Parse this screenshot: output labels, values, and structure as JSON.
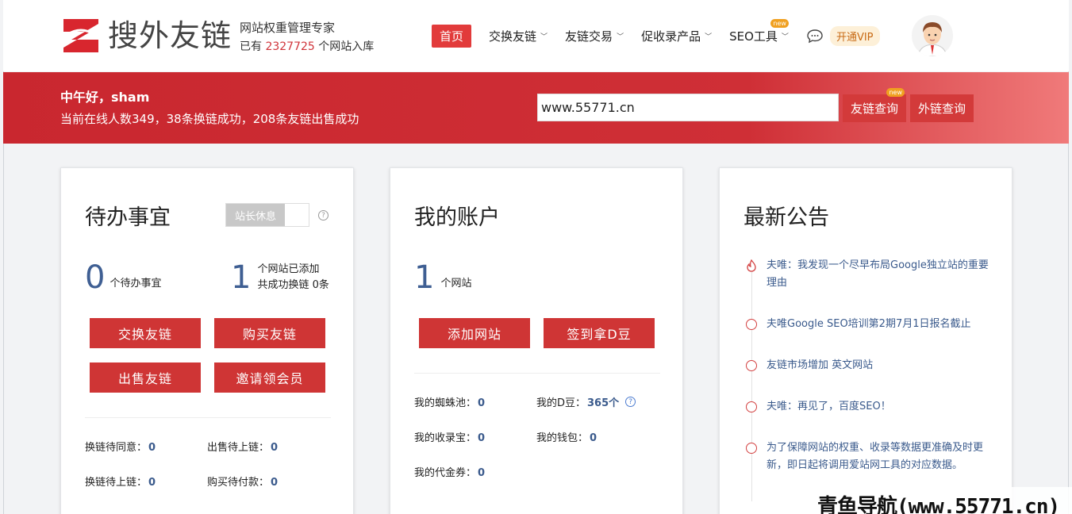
{
  "header": {
    "logo_text": "搜外友链",
    "tagline": "网站权重管理专家",
    "sites_prefix": "已有",
    "sites_count": "2327725",
    "sites_suffix": "个网站入库",
    "nav": [
      {
        "label": "首页"
      },
      {
        "label": "交换友链"
      },
      {
        "label": "友链交易"
      },
      {
        "label": "促收录产品"
      },
      {
        "label": "SEO工具",
        "badge": "new"
      }
    ],
    "vip_label": "开通VIP"
  },
  "banner": {
    "greeting": "中午好，sham",
    "online_text": "当前在线人数349，38条换链成功，208条友链出售成功",
    "search_value": "www.55771.cn",
    "btn_friend_query": "友链查询",
    "btn_friend_badge": "new",
    "btn_outlink_query": "外链查询"
  },
  "todo": {
    "title": "待办事宜",
    "toggle_label": "站长休息",
    "pending_count": "0",
    "pending_label": "个待办事宜",
    "sites_count": "1",
    "sites_line1": "个网站已添加",
    "sites_line2": "共成功换链 0条",
    "buttons": [
      "交换友链",
      "购买友链",
      "出售友链",
      "邀请领会员"
    ],
    "stats": [
      {
        "label": "换链待同意：",
        "value": "0"
      },
      {
        "label": "出售待上链：",
        "value": "0"
      },
      {
        "label": "换链待上链：",
        "value": "0"
      },
      {
        "label": "购买待付款：",
        "value": "0"
      }
    ]
  },
  "account": {
    "title": "我的账户",
    "sites_count": "1",
    "sites_label": "个网站",
    "buttons": [
      "添加网站",
      "签到拿D豆"
    ],
    "stats": [
      {
        "label": "我的蜘蛛池：",
        "value": "0"
      },
      {
        "label": "我的D豆：",
        "value": "365个"
      },
      {
        "label": "我的收录宝：",
        "value": "0"
      },
      {
        "label": "我的钱包：",
        "value": "0"
      },
      {
        "label": "我的代金券：",
        "value": "0"
      }
    ]
  },
  "notices": {
    "title": "最新公告",
    "items": [
      "夫唯：我发现一个尽早布局Google独立站的重要理由",
      "夫唯Google SEO培训第2期7月1日报名截止",
      "友链市场增加 英文网站",
      "夫唯：再见了，百度SEO！",
      "为了保障网站的权重、收录等数据更准确及时更新，即日起将调用爱站网工具的对应数据。"
    ]
  },
  "watermark": "青鱼导航(www.55771.cn)",
  "colors": {
    "brand_red": "#cf3535",
    "link_blue": "#3a5a8c",
    "number_blue": "#3f5f93"
  }
}
